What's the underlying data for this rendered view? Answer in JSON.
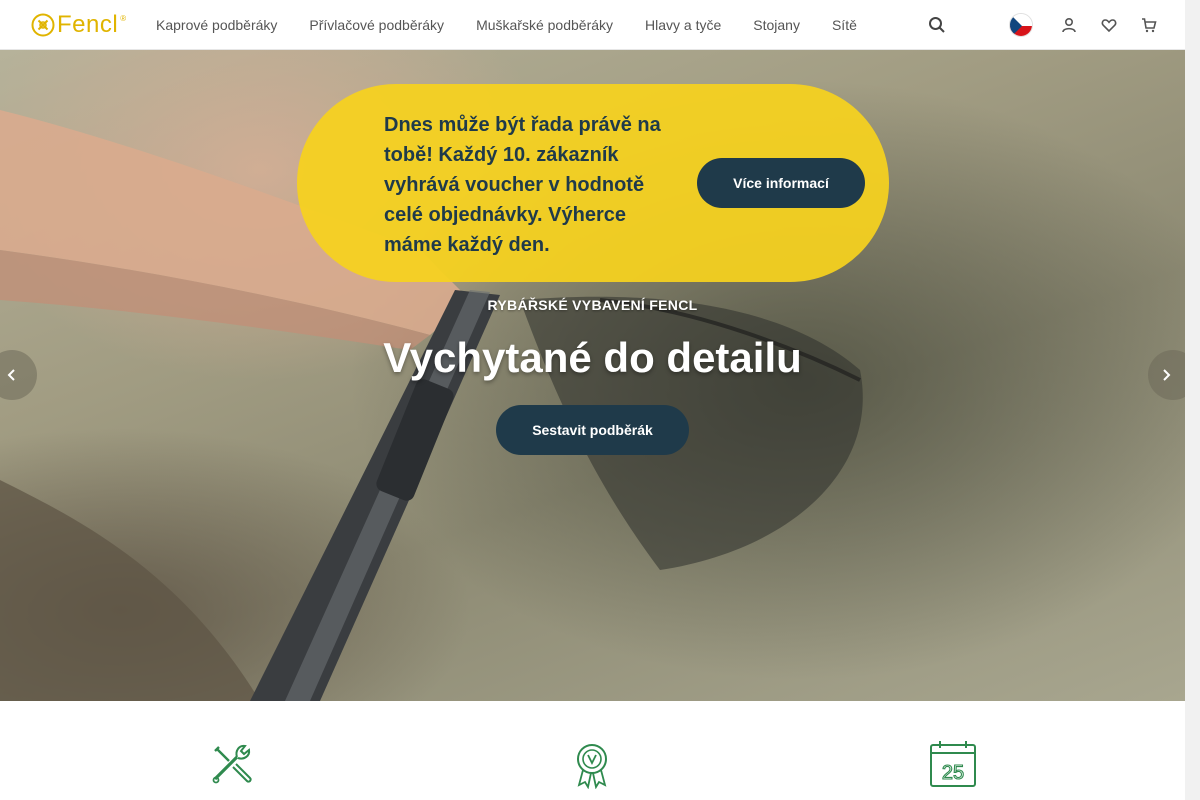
{
  "brand": {
    "logo_text": "Fencl",
    "logo_mark": "®",
    "accent": "#e0b400",
    "navy": "#1f3a4a",
    "promo_yellow": "#f6d21e"
  },
  "nav": {
    "items": [
      {
        "label": "Kaprové podběráky"
      },
      {
        "label": "Přívlačové podběráky"
      },
      {
        "label": "Muškařské podběráky"
      },
      {
        "label": "Hlavy a tyče"
      },
      {
        "label": "Stojany"
      },
      {
        "label": "Sítě"
      }
    ]
  },
  "header_icons": [
    "search-icon",
    "czech-flag-icon",
    "user-icon",
    "heart-icon",
    "cart-icon"
  ],
  "promo": {
    "text": "Dnes může být řada právě na tobě! Každý 10. zákazník vyhrává voucher v hodnotě celé objednávky. Výherce máme každý den.",
    "button": "Více informací"
  },
  "hero": {
    "eyebrow": "RYBÁŘSKÉ VYBAVENÍ FENCL",
    "title": "Vychytané do detailu",
    "button": "Sestavit podběrák"
  },
  "features": [
    {
      "icon": "tools-icon",
      "label": ""
    },
    {
      "icon": "award-badge-icon",
      "label": ""
    },
    {
      "icon": "calendar-25-icon",
      "label": ""
    }
  ]
}
